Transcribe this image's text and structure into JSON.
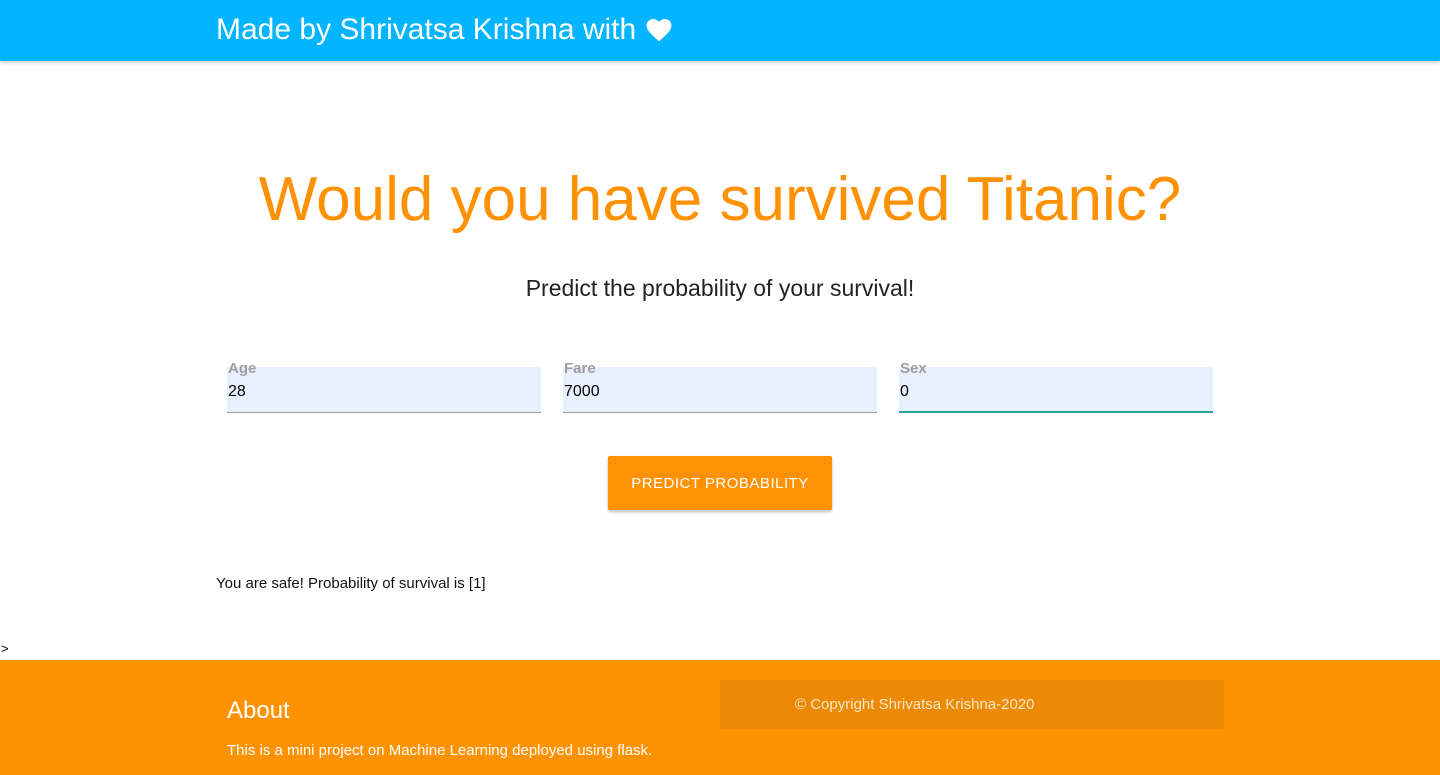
{
  "navbar": {
    "brand_text": "Made by Shrivatsa Krishna with",
    "brand_icon": "heart-icon",
    "background_color": "#03b4ff"
  },
  "hero": {
    "title": "Would you have survived Titanic?",
    "subtitle": "Predict the probability of your survival!",
    "title_color": "#ff9104"
  },
  "form": {
    "fields": [
      {
        "label": "Age",
        "value": "28"
      },
      {
        "label": "Fare",
        "value": "7000"
      },
      {
        "label": "Sex",
        "value": "0"
      }
    ],
    "submit_label": "PREDICT PROBABILITY"
  },
  "result": {
    "text": "You are safe! Probability of survival is [1]"
  },
  "stray_text": ">",
  "footer": {
    "heading": "About",
    "description": "This is a mini project on Machine Learning deployed using flask.",
    "copyright": "© Copyright Shrivatsa Krishna-2020",
    "background_color": "#ff9200"
  }
}
